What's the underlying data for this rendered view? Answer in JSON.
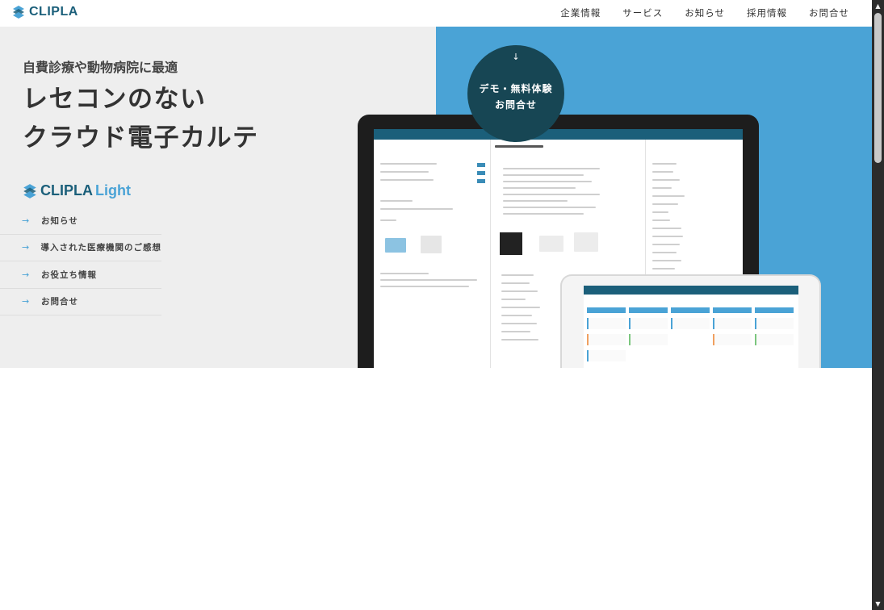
{
  "header": {
    "logo_text": "CLIPLA",
    "nav": [
      "企業情報",
      "サービス",
      "お知らせ",
      "採用情報",
      "お問合せ"
    ]
  },
  "hero": {
    "subtitle": "自費診療や動物病院に最適",
    "title_line1": "レセコンのない",
    "title_line2": "クラウド電子カルテ",
    "product_logo_a": "CLIPLA",
    "product_logo_b": "Light"
  },
  "sub_menu": {
    "arrow": "→",
    "items": [
      "お知らせ",
      "導入された医療機関のご感想",
      "お役立ち情報",
      "お問合せ"
    ]
  },
  "demo_cta": {
    "arrow": "↓",
    "line1": "デモ・無料体験",
    "line2": "お問合せ"
  },
  "colors": {
    "brand_dark": "#1b5f7a",
    "brand_blue": "#4aa3d6",
    "cta_bg": "#174654",
    "hero_gray": "#eeeeee"
  },
  "icons": {
    "logo": "clipla-logo-icon",
    "scroll_up": "▲",
    "scroll_down": "▼"
  }
}
